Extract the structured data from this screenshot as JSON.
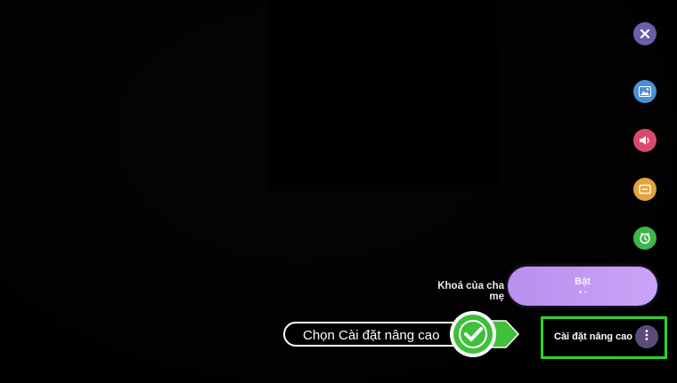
{
  "side_menu": {
    "icons": [
      "close-icon",
      "picture-icon",
      "sound-icon",
      "channel-icon",
      "timer-icon"
    ],
    "colors": {
      "close": "#6a5fa8",
      "picture": "#4a90d9",
      "sound": "#d94a6a",
      "channel": "#e6a23c",
      "timer": "#3fb54a"
    }
  },
  "parental_lock": {
    "label": "Khoá của cha mẹ",
    "value": "Bật",
    "accent": "#c09af3"
  },
  "advanced_settings": {
    "label": "Cài đặt nâng cao",
    "icon": "more-vertical-icon",
    "highlight_color": "#2fd12b"
  },
  "tutorial_callout": {
    "text": "Chọn Cài đặt nâng cao",
    "icon": "checkmark-icon",
    "color": "#3fbf3a"
  }
}
